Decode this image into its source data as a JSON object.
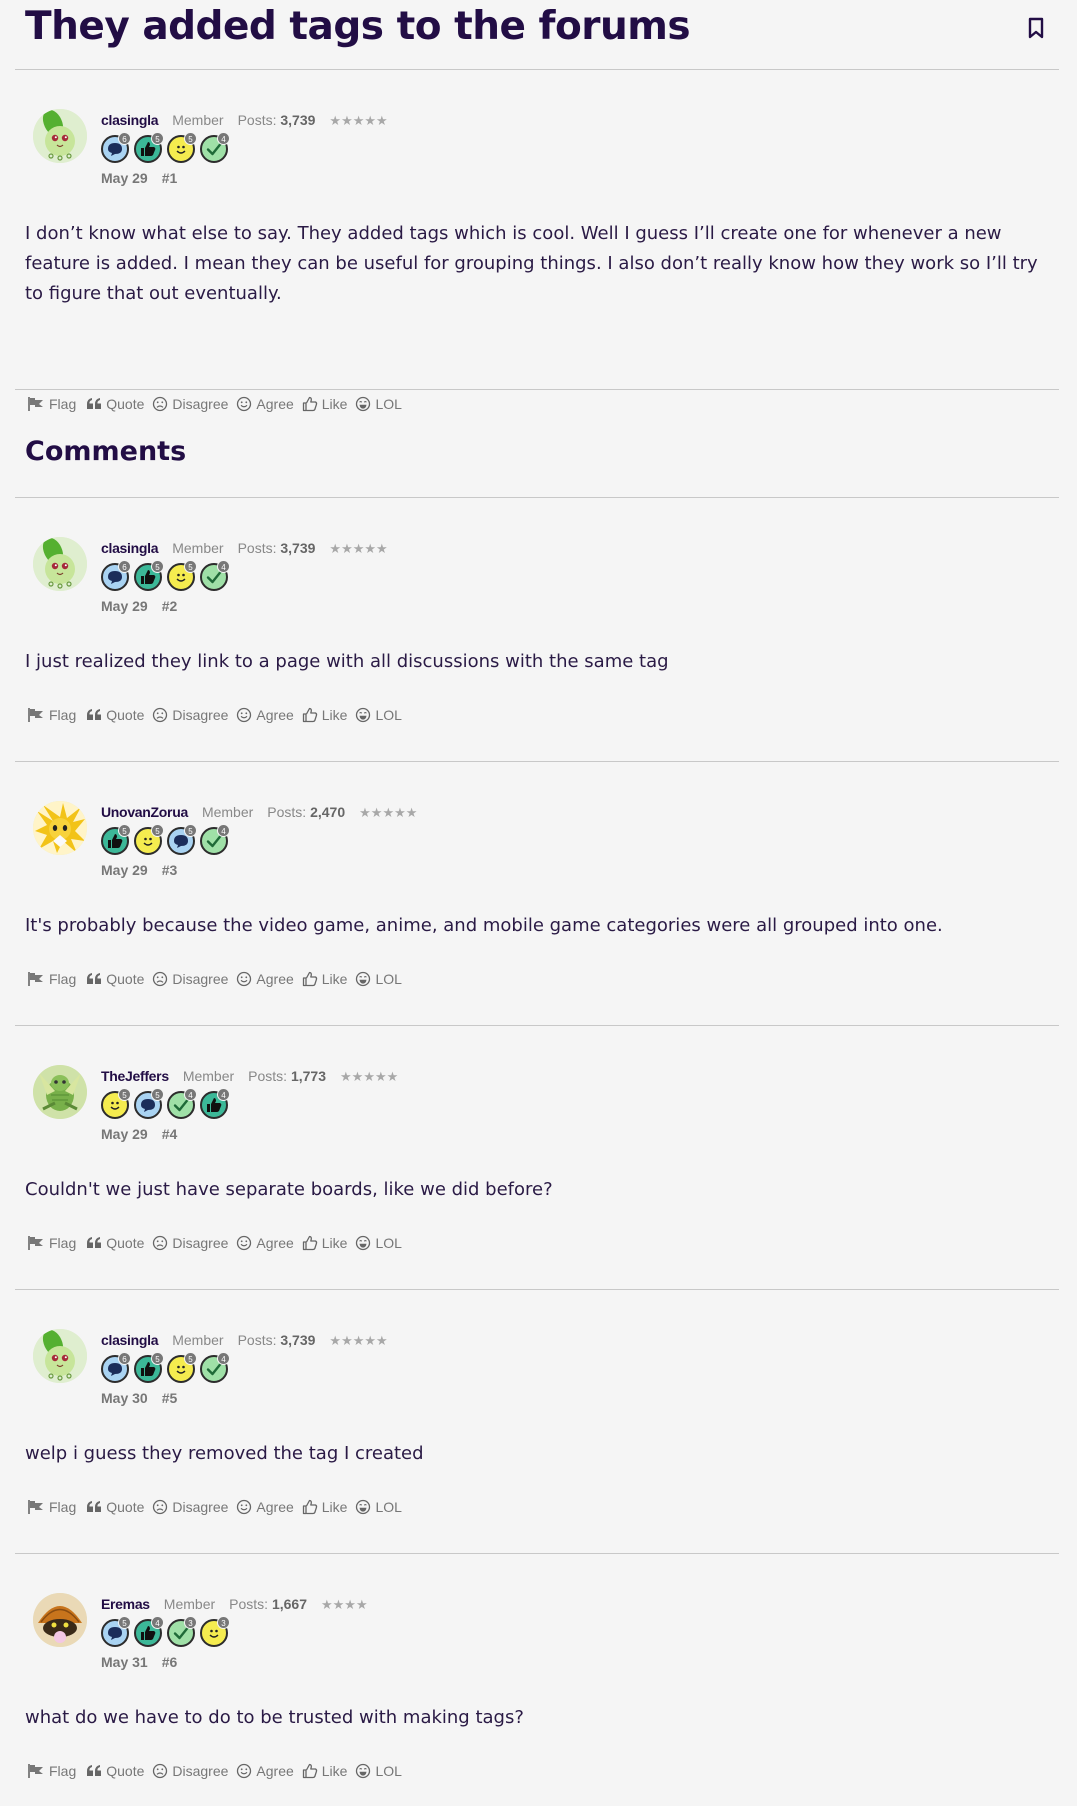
{
  "thread": {
    "title": "They added tags to the forums",
    "bookmark_icon": "bookmark-icon"
  },
  "comments_heading": "Comments",
  "actions": {
    "flag": "Flag",
    "quote": "Quote",
    "disagree": "Disagree",
    "agree": "Agree",
    "like": "Like",
    "lol": "LOL"
  },
  "posts_label": "Posts:",
  "posts": [
    {
      "username": "clasingla",
      "role": "Member",
      "post_count": "3,739",
      "stars": "★★★★★",
      "avatar": "chikorita-avatar",
      "badges": [
        {
          "type": "comment",
          "color": "#a9d3f2",
          "level": "6"
        },
        {
          "type": "like",
          "color": "#3cb898",
          "level": "5"
        },
        {
          "type": "agree",
          "color": "#f5ec4f",
          "level": "5"
        },
        {
          "type": "check",
          "color": "#9fe0a7",
          "level": "4"
        }
      ],
      "date": "May 29",
      "number": "#1",
      "body": "I don’t know what else to say. They added tags which is cool. Well I guess I’ll create one for whenever a new feature is added. I mean they can be useful for grouping things. I also don’t really know how they work so I’ll try to figure that out eventually."
    },
    {
      "username": "clasingla",
      "role": "Member",
      "post_count": "3,739",
      "stars": "★★★★★",
      "avatar": "chikorita-avatar",
      "badges": [
        {
          "type": "comment",
          "color": "#a9d3f2",
          "level": "6"
        },
        {
          "type": "like",
          "color": "#3cb898",
          "level": "5"
        },
        {
          "type": "agree",
          "color": "#f5ec4f",
          "level": "5"
        },
        {
          "type": "check",
          "color": "#9fe0a7",
          "level": "4"
        }
      ],
      "date": "May 29",
      "number": "#2",
      "body": "I just realized they link to a page with all discussions with the same tag"
    },
    {
      "username": "UnovanZorua",
      "role": "Member",
      "post_count": "2,470",
      "stars": "★★★★★",
      "avatar": "jolteon-avatar",
      "badges": [
        {
          "type": "like",
          "color": "#3cb898",
          "level": "5"
        },
        {
          "type": "agree",
          "color": "#f5ec4f",
          "level": "5"
        },
        {
          "type": "comment",
          "color": "#a9d3f2",
          "level": "5"
        },
        {
          "type": "check",
          "color": "#9fe0a7",
          "level": "4"
        }
      ],
      "date": "May 29",
      "number": "#3",
      "body": "It's probably because the video game, anime, and mobile game categories were all grouped into one."
    },
    {
      "username": "TheJeffers",
      "role": "Member",
      "post_count": "1,773",
      "stars": "★★★★★",
      "avatar": "scyther-avatar",
      "badges": [
        {
          "type": "agree",
          "color": "#f5ec4f",
          "level": "5"
        },
        {
          "type": "comment",
          "color": "#a9d3f2",
          "level": "5"
        },
        {
          "type": "check",
          "color": "#9fe0a7",
          "level": "4"
        },
        {
          "type": "like",
          "color": "#3cb898",
          "level": "4"
        }
      ],
      "date": "May 29",
      "number": "#4",
      "body": "Couldn't we just have separate boards, like we did before?"
    },
    {
      "username": "clasingla",
      "role": "Member",
      "post_count": "3,739",
      "stars": "★★★★★",
      "avatar": "chikorita-avatar",
      "badges": [
        {
          "type": "comment",
          "color": "#a9d3f2",
          "level": "6"
        },
        {
          "type": "like",
          "color": "#3cb898",
          "level": "5"
        },
        {
          "type": "agree",
          "color": "#f5ec4f",
          "level": "5"
        },
        {
          "type": "check",
          "color": "#9fe0a7",
          "level": "4"
        }
      ],
      "date": "May 30",
      "number": "#5",
      "body": "welp i guess they removed the tag I created"
    },
    {
      "username": "Eremas",
      "role": "Member",
      "post_count": "1,667",
      "stars": "★★★★",
      "avatar": "kabuto-avatar",
      "badges": [
        {
          "type": "comment",
          "color": "#a9d3f2",
          "level": "5"
        },
        {
          "type": "like",
          "color": "#3cb898",
          "level": "4"
        },
        {
          "type": "check",
          "color": "#9fe0a7",
          "level": "3"
        },
        {
          "type": "agree",
          "color": "#f5ec4f",
          "level": "3"
        }
      ],
      "date": "May 31",
      "number": "#6",
      "body": "what do we have to do to be trusted with making tags?"
    }
  ]
}
